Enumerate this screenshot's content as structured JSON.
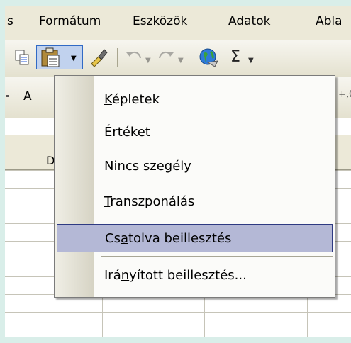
{
  "menubar": {
    "items": [
      {
        "pre": "s",
        "ul": "",
        "post": ""
      },
      {
        "pre": "Formát",
        "ul": "u",
        "post": "m"
      },
      {
        "pre": "",
        "ul": "E",
        "post": "szközök"
      },
      {
        "pre": "A",
        "ul": "d",
        "post": "atok"
      },
      {
        "pre": "",
        "ul": "A",
        "post": "bla"
      }
    ]
  },
  "toolbar": {
    "sigma": "Σ"
  },
  "fmtbar": {
    "font_color_letter": "A",
    "decimal_hint": "+,0"
  },
  "colheader": {
    "visible_letter": "D"
  },
  "paste_menu": {
    "items": [
      {
        "pre": "",
        "ul": "K",
        "post": "épletek"
      },
      {
        "pre": "É",
        "ul": "r",
        "post": "téket"
      },
      {
        "pre": "Ni",
        "ul": "n",
        "post": "cs szegély"
      },
      {
        "pre": "",
        "ul": "T",
        "post": "ranszponálás"
      },
      {
        "pre": "Cs",
        "ul": "a",
        "post": "tolva beillesztés"
      },
      {
        "pre": "Irá",
        "ul": "n",
        "post": "yított beillesztés..."
      }
    ]
  }
}
